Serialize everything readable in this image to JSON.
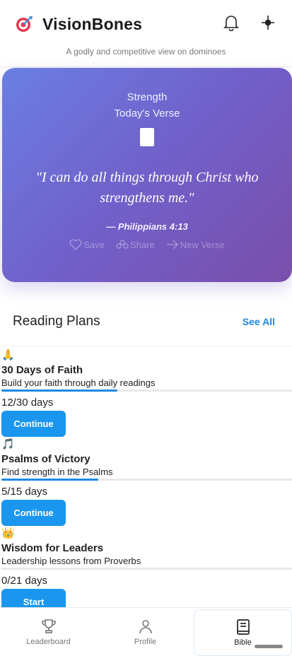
{
  "app": {
    "title": "VisionBones",
    "tagline": "A godly and competitive view on dominoes"
  },
  "icons": {
    "logo": "target-dart-icon",
    "notifications": "bell-icon",
    "settings": "crosshair-icon"
  },
  "verse": {
    "topic": "Strength",
    "heading": "Today's Verse",
    "text": "\"I can do all things through Christ who strengthens me.\"",
    "reference": "— Philippians 4:13",
    "actions": {
      "save": "Save",
      "share": "Share",
      "new_verse": "New Verse"
    }
  },
  "reading_plans": {
    "title": "Reading Plans",
    "see_all": "See All",
    "plans": [
      {
        "emoji": "🙏",
        "title": "30 Days of Faith",
        "description": "Build your faith through daily readings",
        "progress_text": "12/30 days",
        "progress": 0.4,
        "button": "Continue"
      },
      {
        "emoji": "🎵",
        "title": "Psalms of Victory",
        "description": "Find strength in the Psalms",
        "progress_text": "5/15 days",
        "progress": 0.333,
        "button": "Continue"
      },
      {
        "emoji": "👑",
        "title": "Wisdom for Leaders",
        "description": "Leadership lessons from Proverbs",
        "progress_text": "0/21 days",
        "progress": 0,
        "button": "Start"
      }
    ]
  },
  "bottom_nav": {
    "leaderboard": "Leaderboard",
    "profile": "Profile",
    "bible": "Bible"
  },
  "colors": {
    "accent": "#1a96ee",
    "gradient_start": "#6a7fe3",
    "gradient_end": "#7a4eab"
  }
}
